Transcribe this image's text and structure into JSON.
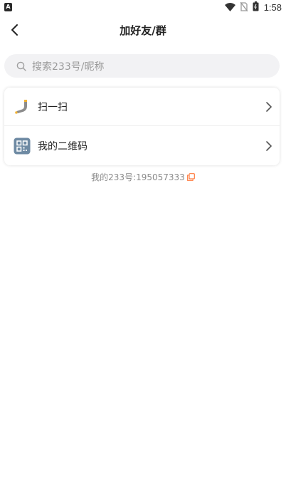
{
  "status_bar": {
    "time": "1:58"
  },
  "nav": {
    "title": "加好友/群"
  },
  "search": {
    "placeholder": "搜索233号/昵称"
  },
  "menu": [
    {
      "label": "扫一扫",
      "icon": "scan-icon"
    },
    {
      "label": "我的二维码",
      "icon": "qr-code-icon"
    }
  ],
  "my_id": {
    "text": "我的233号:195057333"
  },
  "colors": {
    "accent": "#ff7a3d",
    "background": "#ffffff",
    "search_bg": "#f2f2f4"
  }
}
